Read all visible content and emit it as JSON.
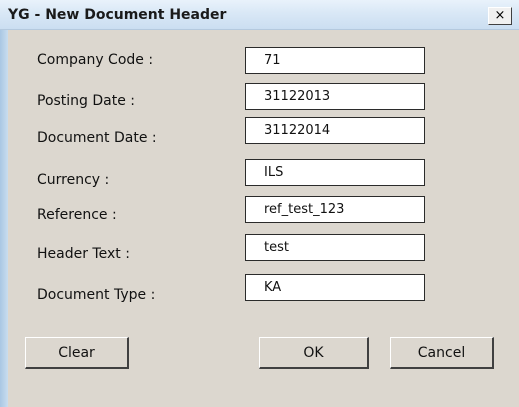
{
  "window": {
    "title": "YG - New Document Header",
    "close_label": "×"
  },
  "fields": [
    {
      "label": "Company Code :",
      "value": "71"
    },
    {
      "label": "Posting Date :",
      "value": "31122013"
    },
    {
      "label": "Document Date :",
      "value": "31122014"
    },
    {
      "label": "Currency :",
      "value": "ILS"
    },
    {
      "label": "Reference :",
      "value": "ref_test_123"
    },
    {
      "label": "Header Text :",
      "value": "test"
    },
    {
      "label": "Document Type :",
      "value": "KA"
    }
  ],
  "buttons": {
    "clear": "Clear",
    "ok": "OK",
    "cancel": "Cancel"
  }
}
